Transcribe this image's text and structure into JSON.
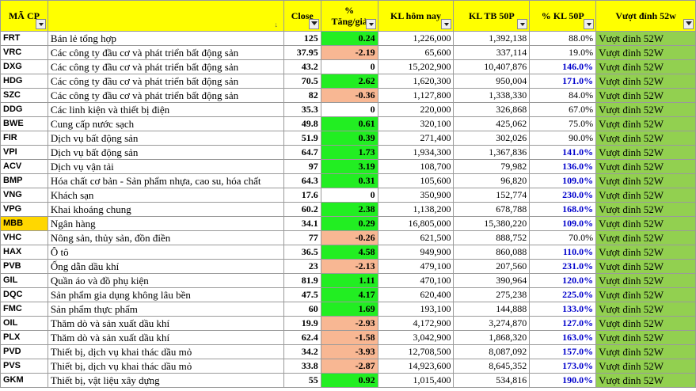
{
  "headers": {
    "code": "MÃ CP",
    "sector": "",
    "close": "Close",
    "pct_change_line1": "%",
    "pct_change_line2": "Tăng/giả",
    "kl_today": "KL hôm nay",
    "kl_avg": "KL TB 50P",
    "pct_kl": "% KL 50P",
    "breakout": "Vượt đỉnh 52w"
  },
  "colors": {
    "header_bg": "#ffff00",
    "positive": "#22ee22",
    "negative": "#f8b793",
    "breakout_bg": "#92d050",
    "highlight_code": "#ffd700",
    "high_volume_text": "#0000cc"
  },
  "rows": [
    {
      "code": "FRT",
      "sector": "Bán lẻ tổng hợp",
      "close": "125",
      "change": "0.24",
      "change_sign": "pos",
      "kl": "1,226,000",
      "kl_avg": "1,392,138",
      "pct_kl": "88.0%",
      "high": false,
      "breakout": "Vượt đỉnh 52W"
    },
    {
      "code": "VRC",
      "sector": "Các công ty đầu cơ và phát triển bất động sản",
      "close": "37.95",
      "change": "-2.19",
      "change_sign": "neg",
      "kl": "65,600",
      "kl_avg": "337,114",
      "pct_kl": "19.0%",
      "high": false,
      "breakout": "Vượt đỉnh 52W"
    },
    {
      "code": "DXG",
      "sector": "Các công ty đầu cơ và phát triển bất động sản",
      "close": "43.2",
      "change": "0",
      "change_sign": "zero",
      "kl": "15,202,900",
      "kl_avg": "10,407,876",
      "pct_kl": "146.0%",
      "high": true,
      "breakout": "Vượt đỉnh 52W"
    },
    {
      "code": "HDG",
      "sector": "Các công ty đầu cơ và phát triển bất động sản",
      "close": "70.5",
      "change": "2.62",
      "change_sign": "pos",
      "kl": "1,620,300",
      "kl_avg": "950,004",
      "pct_kl": "171.0%",
      "high": true,
      "breakout": "Vượt đỉnh 52W"
    },
    {
      "code": "SZC",
      "sector": "Các công ty đầu cơ và phát triển bất động sản",
      "close": "82",
      "change": "-0.36",
      "change_sign": "neg",
      "kl": "1,127,800",
      "kl_avg": "1,338,330",
      "pct_kl": "84.0%",
      "high": false,
      "breakout": "Vượt đỉnh 52W"
    },
    {
      "code": "DDG",
      "sector": "Các linh kiện và thiết bị điện",
      "close": "35.3",
      "change": "0",
      "change_sign": "zero",
      "kl": "220,000",
      "kl_avg": "326,868",
      "pct_kl": "67.0%",
      "high": false,
      "breakout": "Vượt đỉnh 52W"
    },
    {
      "code": "BWE",
      "sector": "Cung cấp nước sạch",
      "close": "49.8",
      "change": "0.61",
      "change_sign": "pos",
      "kl": "320,100",
      "kl_avg": "425,062",
      "pct_kl": "75.0%",
      "high": false,
      "breakout": "Vượt đỉnh 52W"
    },
    {
      "code": "FIR",
      "sector": "Dịch vụ bất động sản",
      "close": "51.9",
      "change": "0.39",
      "change_sign": "pos",
      "kl": "271,400",
      "kl_avg": "302,026",
      "pct_kl": "90.0%",
      "high": false,
      "breakout": "Vượt đỉnh 52W"
    },
    {
      "code": "VPI",
      "sector": "Dịch vụ bất động sản",
      "close": "64.7",
      "change": "1.73",
      "change_sign": "pos",
      "kl": "1,934,300",
      "kl_avg": "1,367,836",
      "pct_kl": "141.0%",
      "high": true,
      "breakout": "Vượt đỉnh 52W"
    },
    {
      "code": "ACV",
      "sector": "Dịch vụ vận tải",
      "close": "97",
      "change": "3.19",
      "change_sign": "pos",
      "kl": "108,700",
      "kl_avg": "79,982",
      "pct_kl": "136.0%",
      "high": true,
      "breakout": "Vượt đỉnh 52W"
    },
    {
      "code": "BMP",
      "sector": "Hóa chất cơ bản - Sản phẩm nhựa, cao su, hóa chất",
      "close": "64.3",
      "change": "0.31",
      "change_sign": "pos",
      "kl": "105,600",
      "kl_avg": "96,820",
      "pct_kl": "109.0%",
      "high": true,
      "breakout": "Vượt đỉnh 52W"
    },
    {
      "code": "VNG",
      "sector": "Khách sạn",
      "close": "17.6",
      "change": "0",
      "change_sign": "zero",
      "kl": "350,900",
      "kl_avg": "152,774",
      "pct_kl": "230.0%",
      "high": true,
      "breakout": "Vượt đỉnh 52W"
    },
    {
      "code": "VPG",
      "sector": "Khai khoáng chung",
      "close": "60.2",
      "change": "2.38",
      "change_sign": "pos",
      "kl": "1,138,200",
      "kl_avg": "678,788",
      "pct_kl": "168.0%",
      "high": true,
      "breakout": "Vượt đỉnh 52W"
    },
    {
      "code": "MBB",
      "sector": "Ngân hàng",
      "close": "34.1",
      "change": "0.29",
      "change_sign": "pos",
      "kl": "16,805,000",
      "kl_avg": "15,380,220",
      "pct_kl": "109.0%",
      "high": true,
      "breakout": "Vượt đỉnh 52W",
      "code_hl": true
    },
    {
      "code": "VHC",
      "sector": "Nông sản, thủy sản, đồn điền",
      "close": "77",
      "change": "-0.26",
      "change_sign": "neg",
      "kl": "621,500",
      "kl_avg": "888,752",
      "pct_kl": "70.0%",
      "high": false,
      "breakout": "Vượt đỉnh 52W"
    },
    {
      "code": "HAX",
      "sector": "Ô tô",
      "close": "36.5",
      "change": "4.58",
      "change_sign": "pos",
      "kl": "949,900",
      "kl_avg": "860,088",
      "pct_kl": "110.0%",
      "high": true,
      "breakout": "Vượt đỉnh 52W"
    },
    {
      "code": "PVB",
      "sector": "Ống dẫn dầu khí",
      "close": "23",
      "change": "-2.13",
      "change_sign": "neg",
      "kl": "479,100",
      "kl_avg": "207,560",
      "pct_kl": "231.0%",
      "high": true,
      "breakout": "Vượt đỉnh 52W"
    },
    {
      "code": "GIL",
      "sector": "Quần áo và đồ phụ kiện",
      "close": "81.9",
      "change": "1.11",
      "change_sign": "pos",
      "kl": "470,100",
      "kl_avg": "390,964",
      "pct_kl": "120.0%",
      "high": true,
      "breakout": "Vượt đỉnh 52W"
    },
    {
      "code": "DQC",
      "sector": "Sản phẩm gia dụng không lâu bền",
      "close": "47.5",
      "change": "4.17",
      "change_sign": "pos",
      "kl": "620,400",
      "kl_avg": "275,238",
      "pct_kl": "225.0%",
      "high": true,
      "breakout": "Vượt đỉnh 52W"
    },
    {
      "code": "FMC",
      "sector": "Sản phẩm thực phẩm",
      "close": "60",
      "change": "1.69",
      "change_sign": "pos",
      "kl": "193,100",
      "kl_avg": "144,888",
      "pct_kl": "133.0%",
      "high": true,
      "breakout": "Vượt đỉnh 52W"
    },
    {
      "code": "OIL",
      "sector": "Thăm dò và sản xuất dầu khí",
      "close": "19.9",
      "change": "-2.93",
      "change_sign": "neg",
      "kl": "4,172,900",
      "kl_avg": "3,274,870",
      "pct_kl": "127.0%",
      "high": true,
      "breakout": "Vượt đỉnh 52W"
    },
    {
      "code": "PLX",
      "sector": "Thăm dò và sản xuất dầu khí",
      "close": "62.4",
      "change": "-1.58",
      "change_sign": "neg",
      "kl": "3,042,900",
      "kl_avg": "1,868,320",
      "pct_kl": "163.0%",
      "high": true,
      "breakout": "Vượt đỉnh 52W"
    },
    {
      "code": "PVD",
      "sector": "Thiết bị, dịch vụ khai thác dầu mỏ",
      "close": "34.2",
      "change": "-3.93",
      "change_sign": "neg",
      "kl": "12,708,500",
      "kl_avg": "8,087,092",
      "pct_kl": "157.0%",
      "high": true,
      "breakout": "Vượt đỉnh 52W"
    },
    {
      "code": "PVS",
      "sector": "Thiết bị, dịch vụ khai thác dầu mỏ",
      "close": "33.8",
      "change": "-2.87",
      "change_sign": "neg",
      "kl": "14,923,600",
      "kl_avg": "8,645,352",
      "pct_kl": "173.0%",
      "high": true,
      "breakout": "Vượt đỉnh 52W"
    },
    {
      "code": "GKM",
      "sector": "Thiết bị, vật liệu xây dựng",
      "close": "55",
      "change": "0.92",
      "change_sign": "pos",
      "kl": "1,015,400",
      "kl_avg": "534,816",
      "pct_kl": "190.0%",
      "high": true,
      "breakout": "Vượt đỉnh 52W"
    }
  ]
}
